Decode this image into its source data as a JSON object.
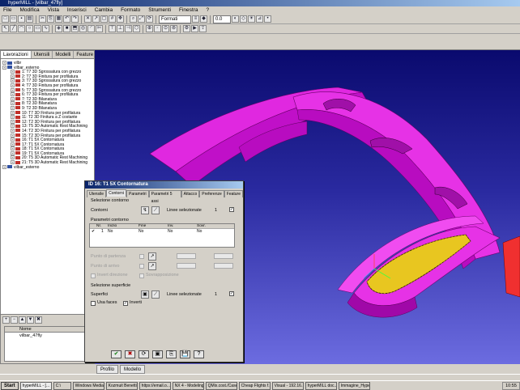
{
  "window": {
    "title": "hyperMILL - [vilbar_47fly]"
  },
  "menu": [
    "File",
    "Modifica",
    "Vista",
    "Inserisci",
    "Cambia",
    "Formato",
    "Strumenti",
    "Finestra",
    "?"
  ],
  "toolbar": {
    "format_combo": "Formati",
    "zoom_combo": "0.0"
  },
  "left_panel": {
    "tabs": [
      "Lavorazioni",
      "Utensili",
      "Modelli",
      "Feature"
    ],
    "tree": [
      {
        "label": "vilbr",
        "indent": 0,
        "icon": "blue"
      },
      {
        "label": "vilbar_esterno",
        "indent": 0,
        "icon": "blue"
      },
      {
        "label": "1: T7 3D Sgrossatura con grezzo",
        "indent": 1,
        "icon": "red"
      },
      {
        "label": "2: T7 3D Finitura per profilatura",
        "indent": 1,
        "icon": "red"
      },
      {
        "label": "3: T7 3D Sgrossatura con grezzo",
        "indent": 1,
        "icon": "red"
      },
      {
        "label": "4: T7 3D Finitura per profilatura",
        "indent": 1,
        "icon": "red"
      },
      {
        "label": "5: T7 3D Sgrossatura con grezzo",
        "indent": 1,
        "icon": "red"
      },
      {
        "label": "6: T7 3D Finitura per profilatura",
        "indent": 1,
        "icon": "red"
      },
      {
        "label": "7: T2 3D Bilanatura",
        "indent": 1,
        "icon": "red"
      },
      {
        "label": "8: T2 3D Bilanatura",
        "indent": 1,
        "icon": "red"
      },
      {
        "label": "9: T2 3D Bilanatura",
        "indent": 1,
        "icon": "red"
      },
      {
        "label": "10: T7 3D Finitura per profilatura",
        "indent": 1,
        "icon": "red"
      },
      {
        "label": "11: T2 3D Finitura a Z costante",
        "indent": 1,
        "icon": "red"
      },
      {
        "label": "12: T2 3D Finitura per profilatura",
        "indent": 1,
        "icon": "red"
      },
      {
        "label": "13: T5 3D Automatic Rest Machining",
        "indent": 1,
        "icon": "red"
      },
      {
        "label": "14: T2 3D Finitura per profilatura",
        "indent": 1,
        "icon": "red"
      },
      {
        "label": "15: T2 3D Finitura per profilatura",
        "indent": 1,
        "icon": "red"
      },
      {
        "label": "16: T1 5X Contornatura",
        "indent": 1,
        "icon": "red"
      },
      {
        "label": "17: T1 5X Contornatura",
        "indent": 1,
        "icon": "red"
      },
      {
        "label": "18: T1 5X Contornatura",
        "indent": 1,
        "icon": "red"
      },
      {
        "label": "19: T1 5X Contornatura",
        "indent": 1,
        "icon": "red"
      },
      {
        "label": "20: T5 3D Automatic Rest Machining",
        "indent": 1,
        "icon": "red"
      },
      {
        "label": "21: T5 3D Automatic Rest Machining",
        "indent": 1,
        "icon": "red"
      },
      {
        "label": "vilbar_esterno",
        "indent": 0,
        "icon": "blue"
      }
    ],
    "bottom": {
      "column_header": "Nome",
      "row": "vilbar_47fly"
    }
  },
  "dialog": {
    "title": "ID 16: T1 5X Contornatura",
    "tabs": [
      "Utensile",
      "Contorni",
      "Parametri",
      "Parametri 5 assi",
      "Attacco",
      "Preferenze",
      "Feature"
    ],
    "group_contorni": {
      "title": "Selezione contorno",
      "field_label": "Contorni",
      "lines_selected_label": "Linee selezionate",
      "lines_selected_value": "1"
    },
    "group_parametri": {
      "title": "Parametri contorno",
      "columns": [
        "Nr.",
        "Inizio",
        "Fine",
        "Inv.",
        "Sovr."
      ],
      "row": {
        "nr": "1",
        "inizio": "No",
        "fine": "No",
        "inv": "No",
        "sovr": "No"
      },
      "disabled_labels": [
        "Punto di partenza",
        "Punto di arrivo",
        "Invert direzione",
        "Sovrapposizione"
      ]
    },
    "group_superficie": {
      "title": "Selezione superficie",
      "field_label": "Superfici",
      "lines_selected_label": "Linee selezionate",
      "lines_selected_value": "1",
      "checkbox_use_face": "Usa faces",
      "checkbox_invert": "Inverti"
    },
    "buttons": [
      "✔",
      "✖",
      "⟳",
      "▣",
      "⎘",
      "💾",
      "?"
    ]
  },
  "view_tabs": [
    "Profilo",
    "Modello"
  ],
  "taskbar": {
    "start": "Start",
    "tasks": [
      "hyperMILL - [...",
      "C:\\",
      "Windows Media...",
      "Kozmuit Benetti...",
      "https://email.o...",
      "NX 4 - Modeling...",
      "QMix.cost./Casell...",
      "Cheap Flights f...",
      "Visual - 192.16...",
      "hyperMILL doc...",
      "Immagine_Hyper..."
    ],
    "clock": "10:55"
  }
}
